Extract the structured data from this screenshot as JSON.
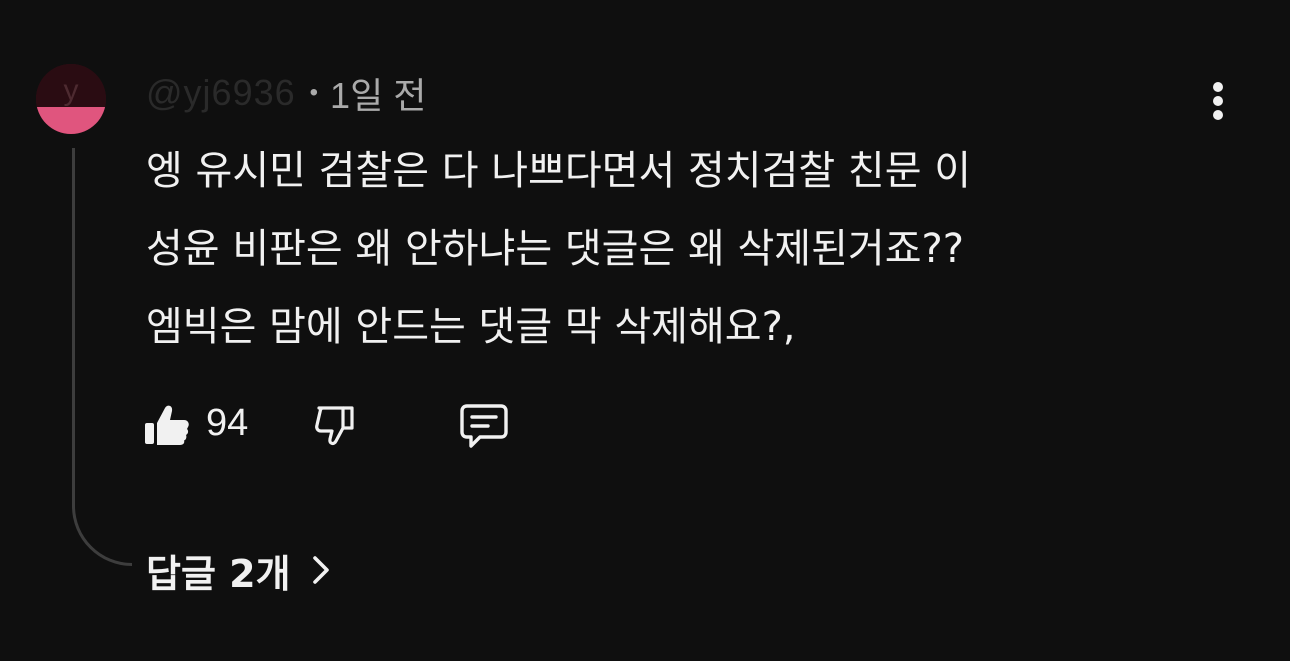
{
  "comment": {
    "avatar_letter": "y",
    "username": "@yj6936",
    "separator": "•",
    "time": "1일 전",
    "text_lines": [
      "엥 유시민 검찰은 다 나쁘다면서 정치검찰 친문 이",
      "성윤 비판은 왜 안하냐는 댓글은 왜 삭제된거죠??",
      "엠빅은 맘에 안드는 댓글 막 삭제해요?,"
    ],
    "likes": "94",
    "replies_label": "답글 2개"
  },
  "icons": {
    "more": "more-vertical-icon",
    "like": "thumbs-up-icon",
    "dislike": "thumbs-down-icon",
    "reply": "comment-icon",
    "chevron": "chevron-right-icon"
  },
  "colors": {
    "background": "#0f0f0f",
    "text": "#f1f1f1",
    "secondary_text": "#aaaaaa",
    "avatar_accent": "#e0557e",
    "thread_line": "#3d3d3d"
  }
}
